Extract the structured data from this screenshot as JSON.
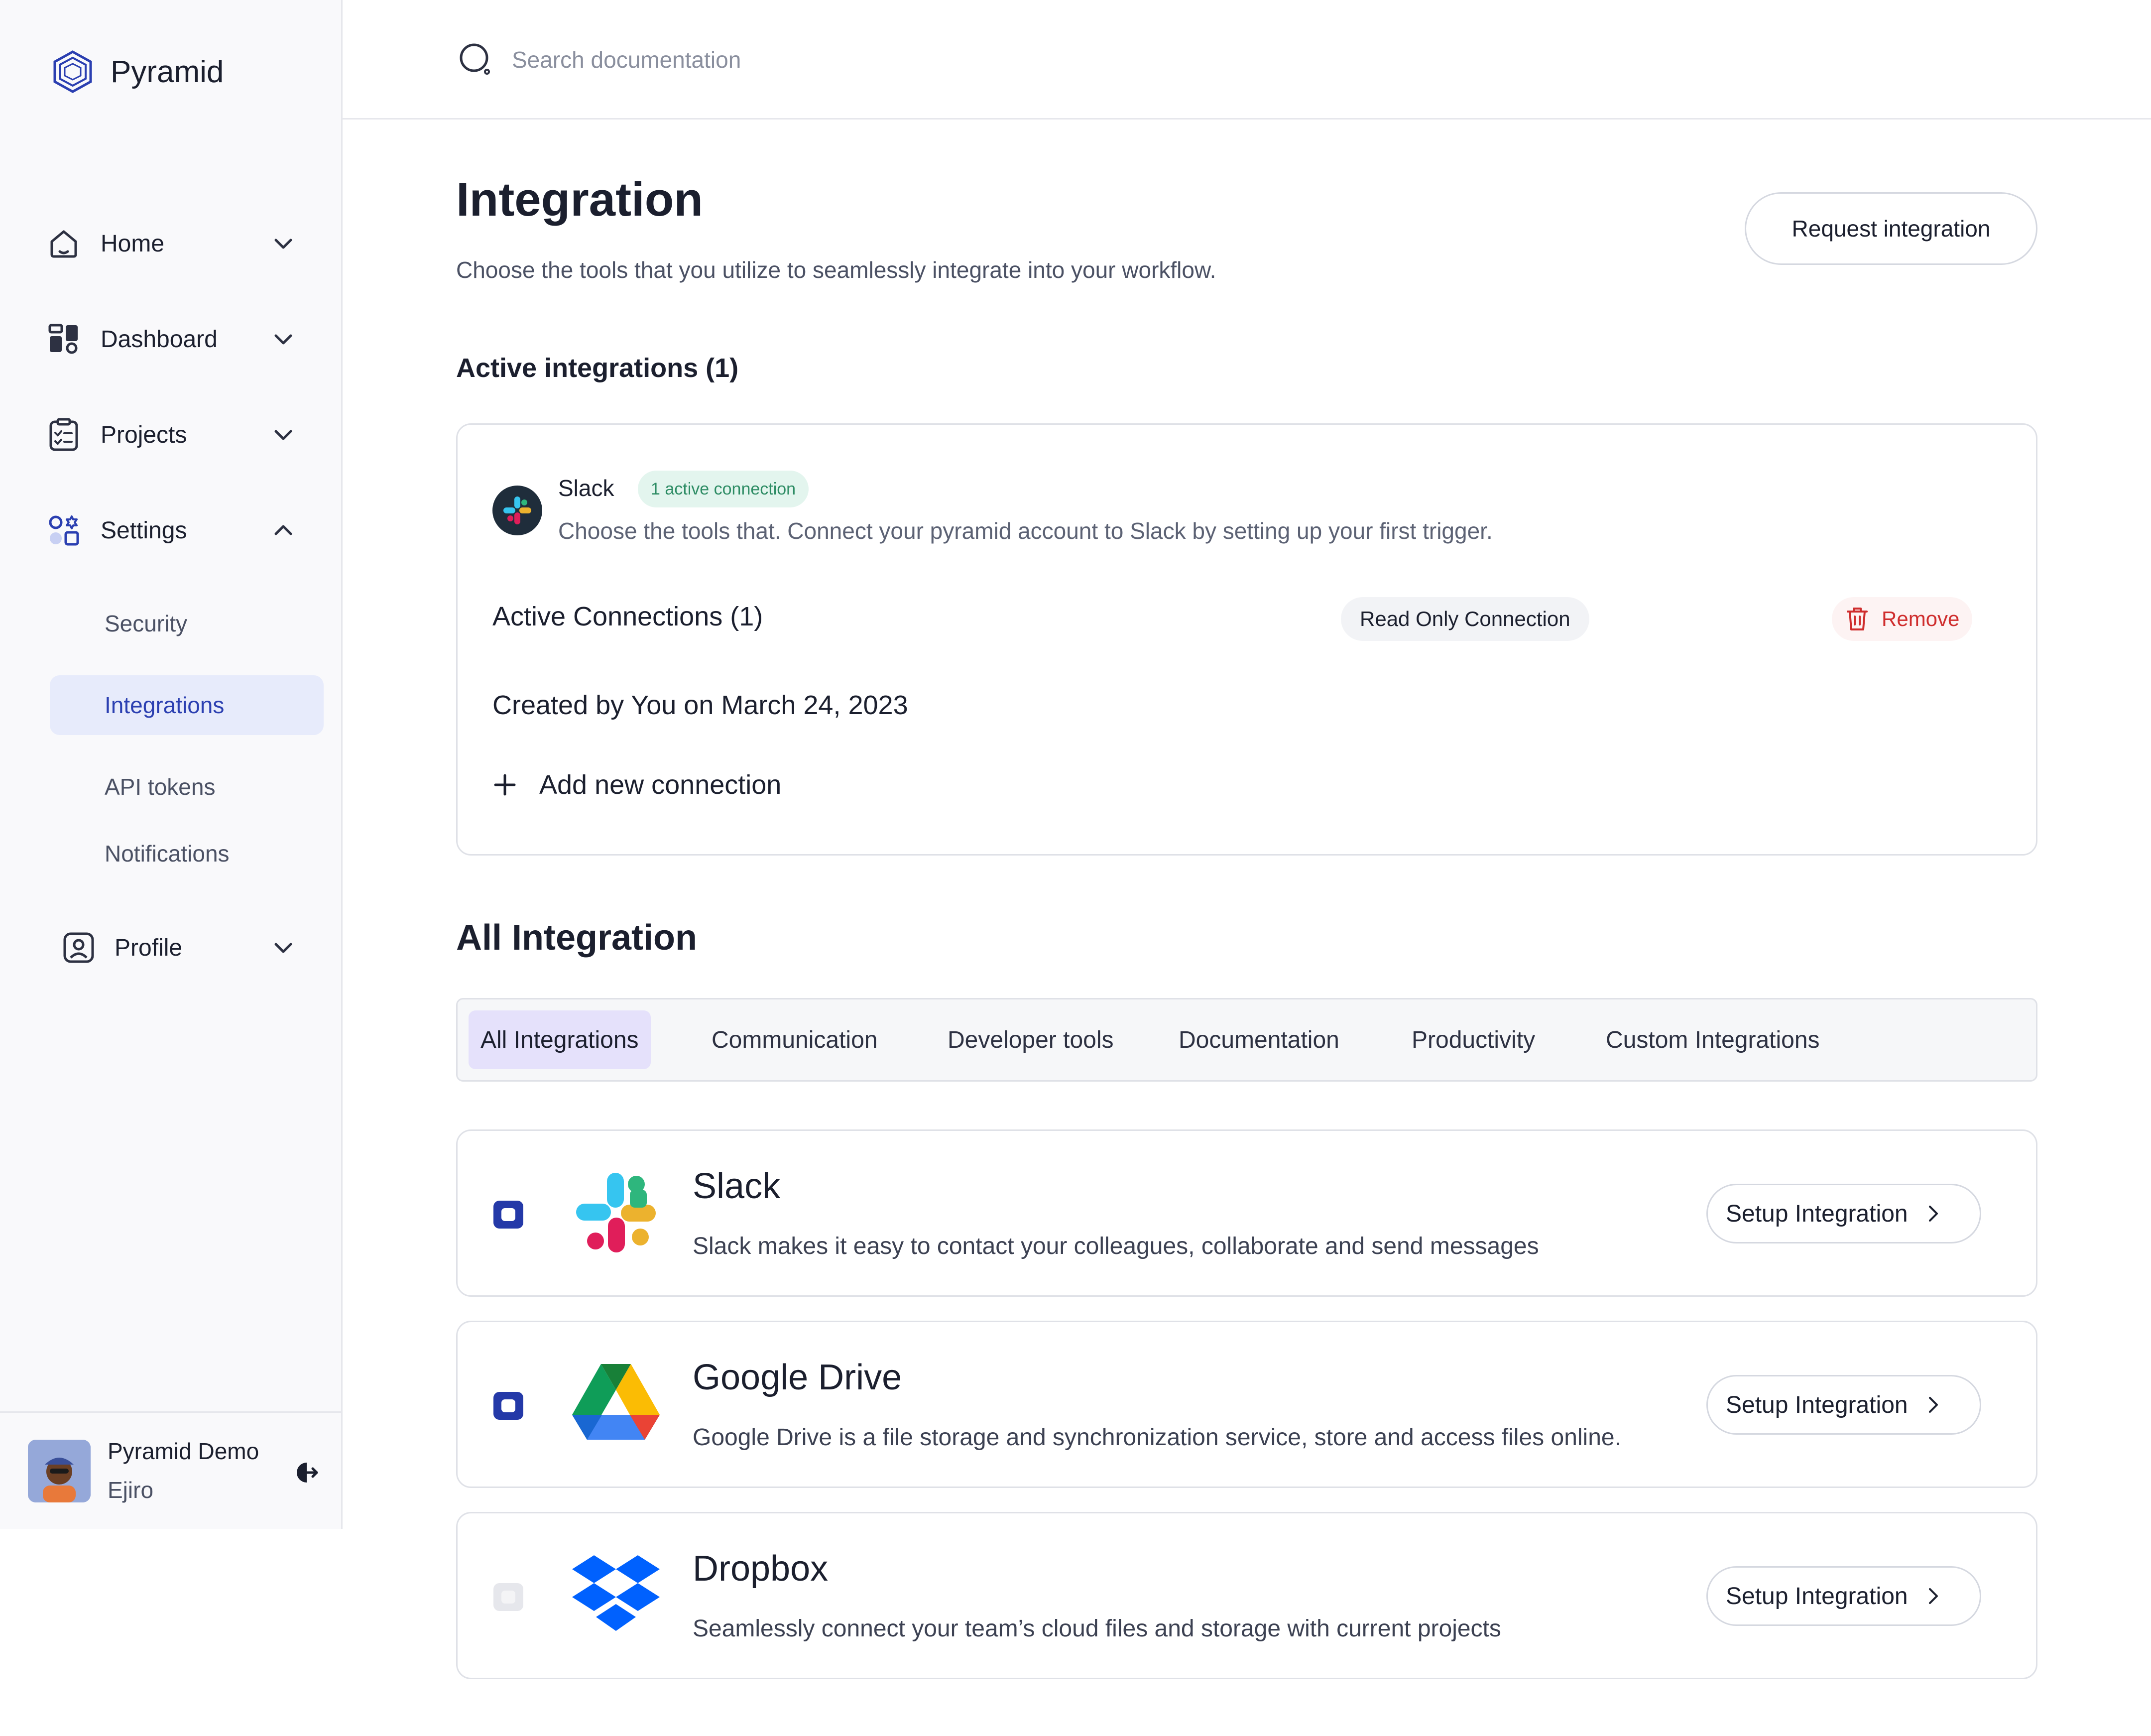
{
  "brand": {
    "name": "Pyramid",
    "icon": "pyramid-logo-icon"
  },
  "search": {
    "placeholder": "Search documentation",
    "icon": "search-icon"
  },
  "sidebar": {
    "nav": [
      {
        "label": "Home",
        "icon": "home-icon",
        "expanded": false
      },
      {
        "label": "Dashboard",
        "icon": "dashboard-icon",
        "expanded": false
      },
      {
        "label": "Projects",
        "icon": "clipboard-icon",
        "expanded": false
      },
      {
        "label": "Settings",
        "icon": "settings-shapes-icon",
        "expanded": true
      },
      {
        "label": "Profile",
        "icon": "profile-icon",
        "expanded": false
      }
    ],
    "settings_sub": [
      {
        "label": "Security",
        "active": false
      },
      {
        "label": "Integrations",
        "active": true
      },
      {
        "label": "API tokens",
        "active": false
      },
      {
        "label": "Notifications",
        "active": false
      }
    ],
    "user": {
      "name": "Pyramid Demo",
      "sub": "Ejiro"
    }
  },
  "page": {
    "title": "Integration",
    "subtitle": "Choose the tools that you utilize to seamlessly integrate into your workflow.",
    "request_button": "Request integration"
  },
  "active_integrations": {
    "heading": "Active integrations (1)",
    "card": {
      "name": "Slack",
      "badge": "1 active connection",
      "description": "Choose the tools that. Connect your pyramid account to Slack by setting up your first trigger.",
      "connections_label": "Active Connections (1)",
      "connection_type": "Read Only Connection",
      "remove_label": "Remove",
      "created": "Created by You on March 24, 2023",
      "add_label": "Add new connection"
    }
  },
  "all_integrations": {
    "heading": "All Integration",
    "tabs": [
      {
        "label": "All Integrations",
        "active": true
      },
      {
        "label": "Communication",
        "active": false
      },
      {
        "label": "Developer tools",
        "active": false
      },
      {
        "label": "Documentation",
        "active": false
      },
      {
        "label": "Productivity",
        "active": false
      },
      {
        "label": "Custom Integrations",
        "active": false
      }
    ],
    "items": [
      {
        "name": "Slack",
        "description": "Slack makes it easy to contact your colleagues, collaborate and send messages",
        "button": "Setup Integration",
        "checked": true,
        "logo": "slack-logo-icon"
      },
      {
        "name": "Google Drive",
        "description": "Google Drive is a file storage and synchronization service, store and access files online.",
        "button": "Setup Integration",
        "checked": true,
        "logo": "google-drive-logo-icon"
      },
      {
        "name": "Dropbox",
        "description": "Seamlessly connect your team’s cloud files and storage with current projects",
        "button": "Setup Integration",
        "checked": false,
        "logo": "dropbox-logo-icon"
      }
    ]
  },
  "colors": {
    "accent": "#2b3fb1",
    "active_tab": "#e5e1fb",
    "danger": "#cf2d2d",
    "success_badge": "#2d8c64"
  }
}
